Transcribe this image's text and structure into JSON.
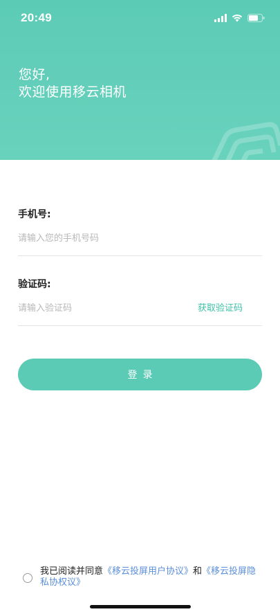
{
  "status_bar": {
    "time": "20:49"
  },
  "hero": {
    "greeting_line1": "您好,",
    "greeting_line2": "欢迎使用移云相机"
  },
  "form": {
    "phone_label": "手机号:",
    "phone_placeholder": "请输入您的手机号码",
    "code_label": "验证码:",
    "code_placeholder": "请输入验证码",
    "get_code_label": "获取验证码"
  },
  "login_button": {
    "label": "登录"
  },
  "agreement": {
    "prefix": "我已阅读并同意",
    "user_agreement": "《移云投屏用户协议》",
    "conjunction": "和",
    "privacy_agreement": "《移云投屏隐私协权议》"
  },
  "colors": {
    "accent": "#5ccbb6",
    "link": "#5b8fd8",
    "get_code": "#3fc1a8"
  }
}
